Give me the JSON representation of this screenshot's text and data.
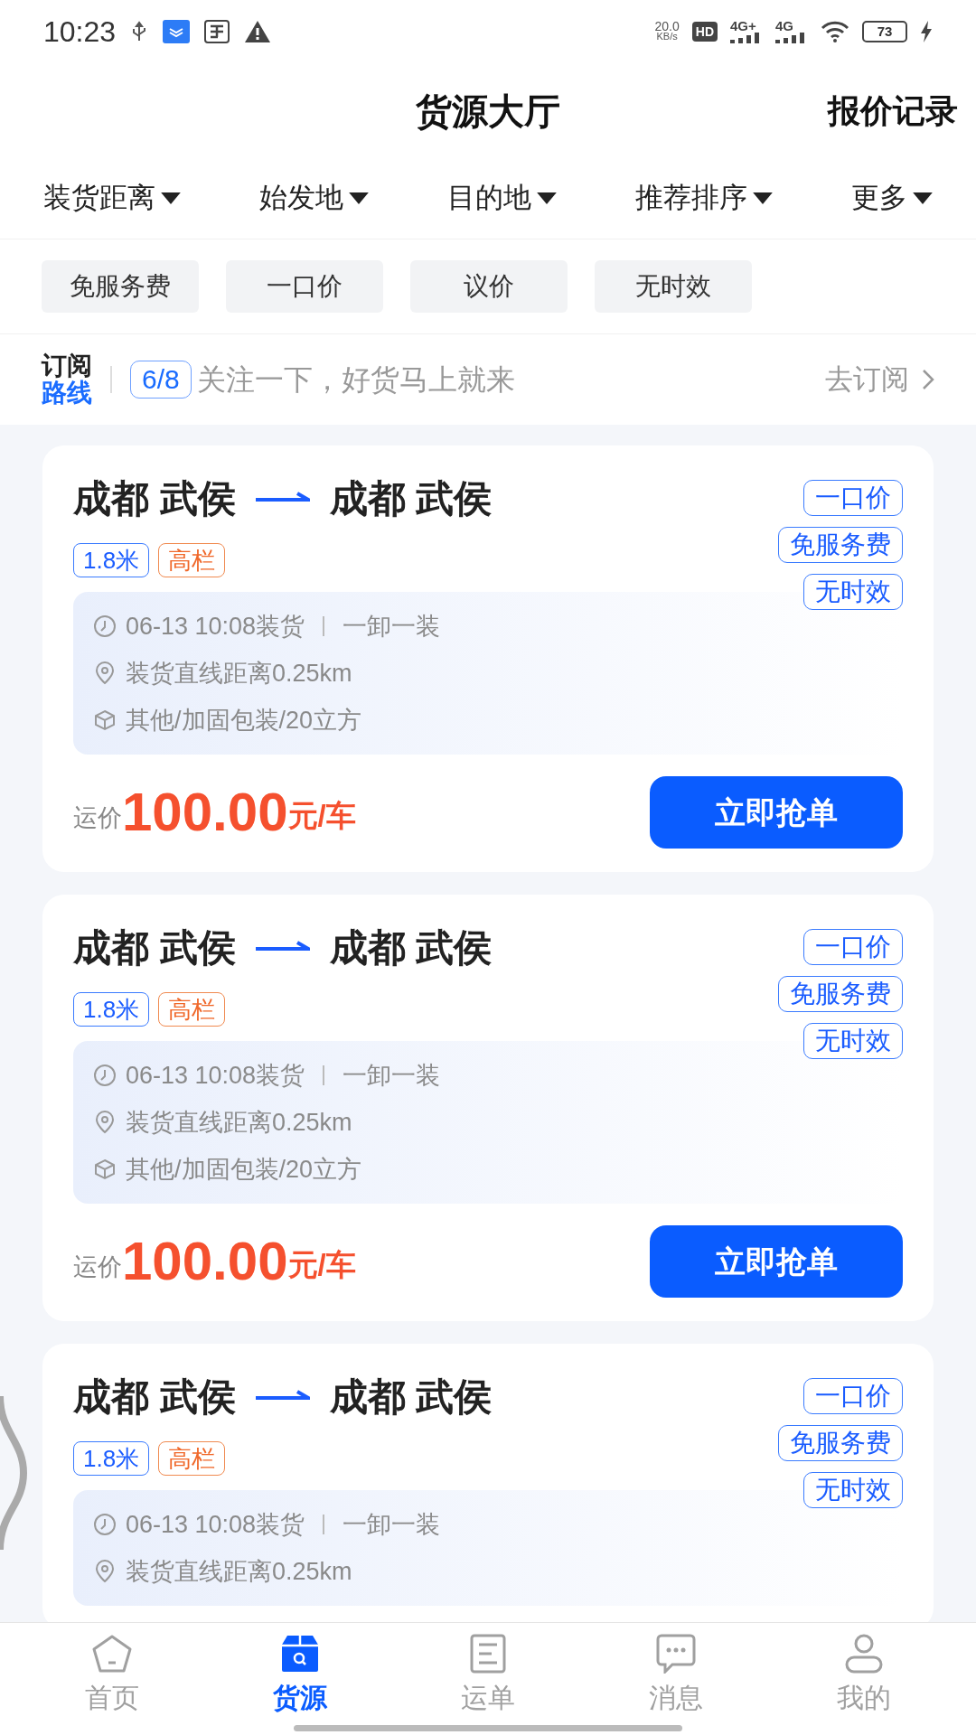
{
  "status_bar": {
    "time": "10:23",
    "net_speed": "20.0",
    "net_speed_unit": "KB/s",
    "hd_badge": "HD",
    "network_1": "4G+",
    "network_2": "4G",
    "battery": "73"
  },
  "header": {
    "title": "货源大厅",
    "action": "报价记录"
  },
  "filters": [
    "装货距离",
    "始发地",
    "目的地",
    "推荐排序",
    "更多"
  ],
  "quick_tags": [
    "免服务费",
    "一口价",
    "议价",
    "无时效"
  ],
  "subscription": {
    "logo_top": "订阅",
    "logo_bottom": "路线",
    "count": "6/8",
    "message": "关注一下，好货马上就来",
    "action": "去订阅"
  },
  "cards": [
    {
      "from": "成都 武侯",
      "to": "成都 武侯",
      "tags": [
        {
          "label": "1.8米",
          "kind": "size"
        },
        {
          "label": "高栏",
          "kind": "body"
        }
      ],
      "badges": [
        "一口价",
        "免服务费",
        "无时效"
      ],
      "details": [
        {
          "kind": "time",
          "text": "06-13 10:08装货",
          "extra": "一卸一装"
        },
        {
          "kind": "distance",
          "text": "装货直线距离0.25km"
        },
        {
          "kind": "cargo",
          "text": "其他/加固包装/20立方"
        }
      ],
      "price_label": "运价",
      "price": "100.00",
      "price_unit": "元/车",
      "button": "立即抢单"
    },
    {
      "from": "成都 武侯",
      "to": "成都 武侯",
      "tags": [
        {
          "label": "1.8米",
          "kind": "size"
        },
        {
          "label": "高栏",
          "kind": "body"
        }
      ],
      "badges": [
        "一口价",
        "免服务费",
        "无时效"
      ],
      "details": [
        {
          "kind": "time",
          "text": "06-13 10:08装货",
          "extra": "一卸一装"
        },
        {
          "kind": "distance",
          "text": "装货直线距离0.25km"
        },
        {
          "kind": "cargo",
          "text": "其他/加固包装/20立方"
        }
      ],
      "price_label": "运价",
      "price": "100.00",
      "price_unit": "元/车",
      "button": "立即抢单"
    },
    {
      "from": "成都 武侯",
      "to": "成都 武侯",
      "tags": [
        {
          "label": "1.8米",
          "kind": "size"
        },
        {
          "label": "高栏",
          "kind": "body"
        }
      ],
      "badges": [
        "一口价",
        "免服务费",
        "无时效"
      ],
      "details": [
        {
          "kind": "time",
          "text": "06-13 10:08装货",
          "extra": "一卸一装"
        },
        {
          "kind": "distance",
          "text": "装货直线距离0.25km"
        }
      ]
    }
  ],
  "tab_bar": [
    {
      "label": "首页",
      "kind": "home",
      "selected": false
    },
    {
      "label": "货源",
      "kind": "box",
      "selected": true
    },
    {
      "label": "运单",
      "kind": "list",
      "selected": false
    },
    {
      "label": "消息",
      "kind": "chat",
      "selected": false
    },
    {
      "label": "我的",
      "kind": "person",
      "selected": false
    }
  ]
}
